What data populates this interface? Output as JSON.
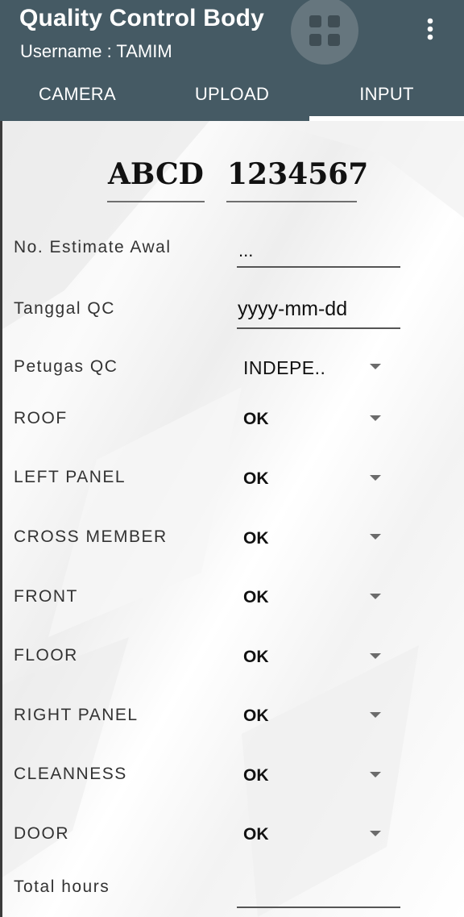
{
  "app": {
    "title": "Quality Control Body",
    "username": "Username : TAMIM"
  },
  "tabs": [
    {
      "label": "CAMERA",
      "selected": false
    },
    {
      "label": "UPLOAD",
      "selected": false
    },
    {
      "label": "INPUT",
      "selected": true
    }
  ],
  "plate": {
    "letters": "ABCD",
    "number": "1234567"
  },
  "form": {
    "estimate": {
      "label": "No. Estimate Awal",
      "value": "..."
    },
    "date": {
      "label": "Tanggal QC",
      "placeholder": "yyyy-mm-dd"
    },
    "officer": {
      "label": "Petugas QC",
      "value": "INDEPE.."
    },
    "checks": [
      {
        "label": "ROOF",
        "value": "OK"
      },
      {
        "label": "LEFT PANEL",
        "value": "OK"
      },
      {
        "label": "CROSS MEMBER",
        "value": "OK"
      },
      {
        "label": "FRONT",
        "value": "OK"
      },
      {
        "label": "FLOOR",
        "value": "OK"
      },
      {
        "label": "RIGHT PANEL",
        "value": "OK"
      },
      {
        "label": "CLEANNESS",
        "value": "OK"
      },
      {
        "label": "DOOR",
        "value": "OK"
      }
    ],
    "total_hours": {
      "label": "Total hours",
      "value": ""
    }
  },
  "colors": {
    "appbar": "#455a64",
    "grid_button": "#66767e",
    "tab_indicator": "#ffffff"
  },
  "icons": {
    "grid": "grid-icon",
    "overflow": "more-vert-icon",
    "dropdown": "arrow-drop-down-icon"
  }
}
